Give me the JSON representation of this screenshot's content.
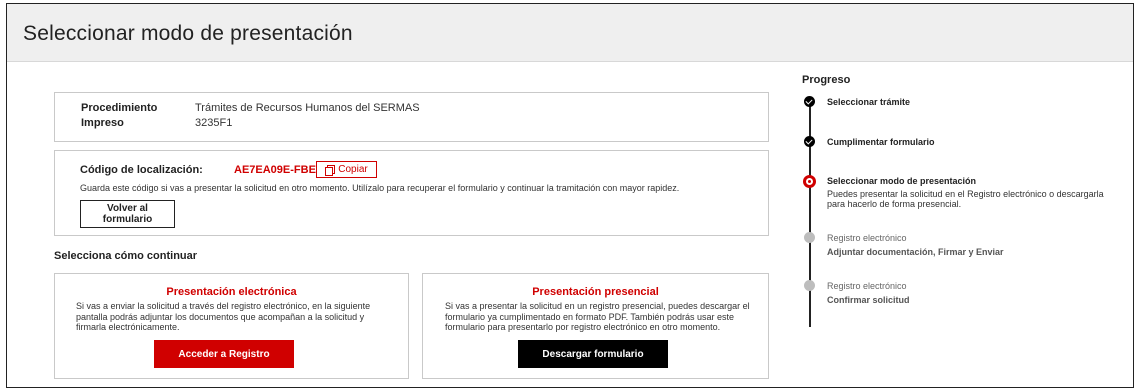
{
  "page": {
    "title": "Seleccionar modo de presentación"
  },
  "summary": {
    "procedure_label": "Procedimiento",
    "procedure_value": "Trámites de Recursos Humanos del SERMAS",
    "form_label": "Impreso",
    "form_value": "3235F1"
  },
  "localization": {
    "label": "Código de localización:",
    "code": "AE7EA09E-FBE1",
    "copy_label": "Copiar",
    "help": "Guarda este código si vas a presentar la solicitud en otro momento. Utilízalo para recuperar el formulario y continuar la tramitación con mayor rapidez.",
    "back_label": "Volver al formulario"
  },
  "continue": {
    "title": "Selecciona cómo continuar",
    "electronic": {
      "title": "Presentación electrónica",
      "text": "Si vas a enviar la solicitud a través del registro electrónico, en la siguiente pantalla podrás adjuntar los documentos que acompañan a la solicitud y firmarla electrónicamente.",
      "button": "Acceder a Registro"
    },
    "presencial": {
      "title": "Presentación presencial",
      "text": "Si vas a presentar la solicitud en un registro presencial, puedes descargar el formulario ya cumplimentado en formato PDF. También podrás usar este formulario para presentarlo por registro electrónico en otro momento.",
      "button": "Descargar formulario"
    }
  },
  "progress": {
    "title": "Progreso",
    "steps": [
      {
        "label": "Seleccionar trámite",
        "status": "done"
      },
      {
        "label": "Cumplimentar formulario",
        "status": "done"
      },
      {
        "label": "Seleccionar modo de presentación",
        "status": "current",
        "description": "Puedes presentar la solicitud en el Registro electrónico o descargarla para hacerlo de forma presencial."
      },
      {
        "label": "Registro electrónico",
        "detail": "Adjuntar documentación, Firmar y Enviar",
        "status": "pending"
      },
      {
        "label": "Registro electrónico",
        "detail": "Confirmar solicitud",
        "status": "pending"
      }
    ]
  },
  "colors": {
    "accent": "#d00000",
    "header_bg": "#efefef",
    "primary_dark": "#000000"
  }
}
